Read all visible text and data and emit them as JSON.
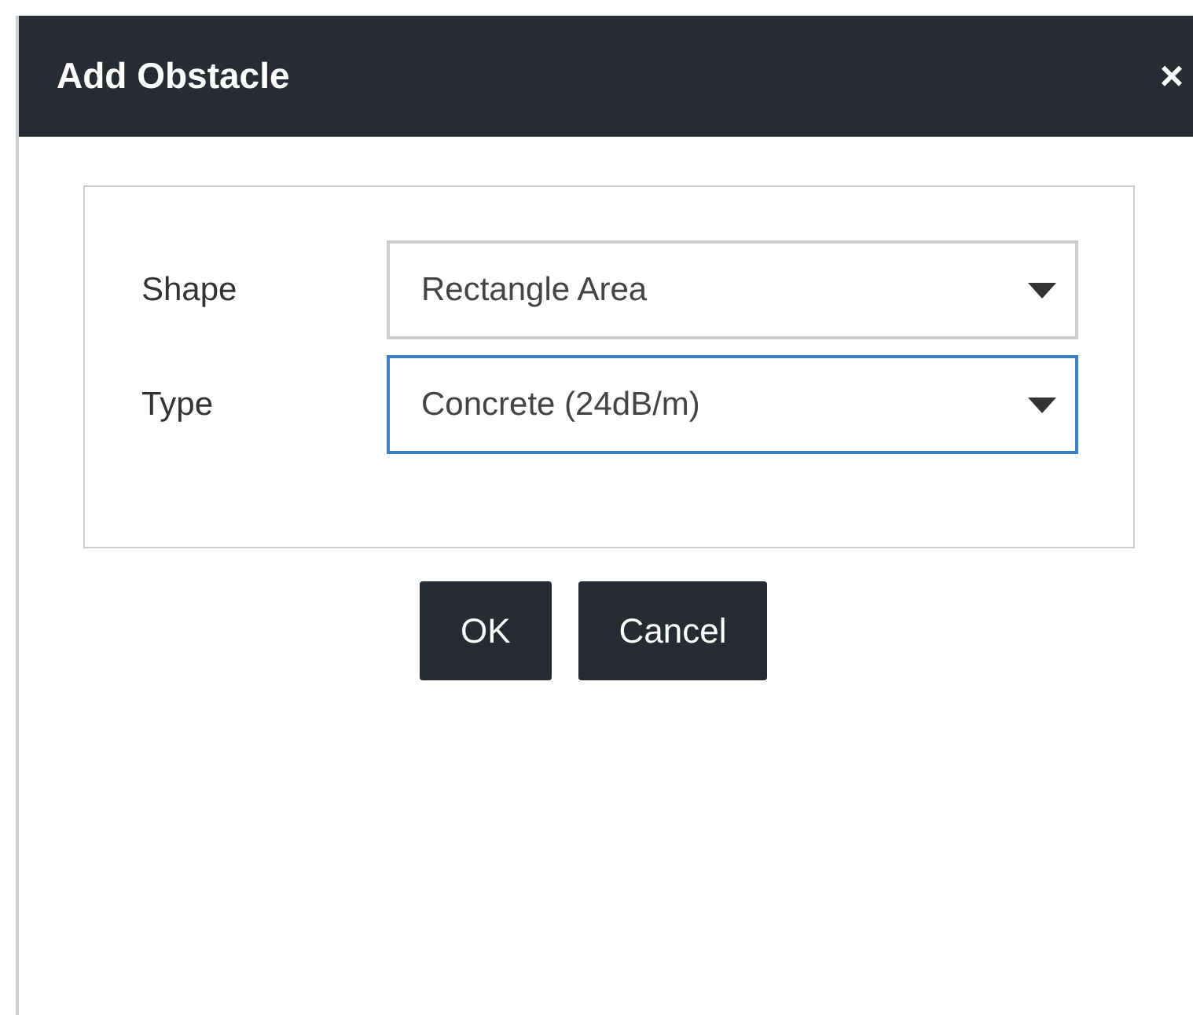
{
  "dialog": {
    "title": "Add Obstacle",
    "close": "×"
  },
  "fields": [
    {
      "label": "Shape",
      "value": "Rectangle Area",
      "focused": false
    },
    {
      "label": "Type",
      "value": "Concrete (24dB/m)",
      "focused": true
    }
  ],
  "buttons": [
    {
      "label": "OK"
    },
    {
      "label": "Cancel"
    }
  ]
}
